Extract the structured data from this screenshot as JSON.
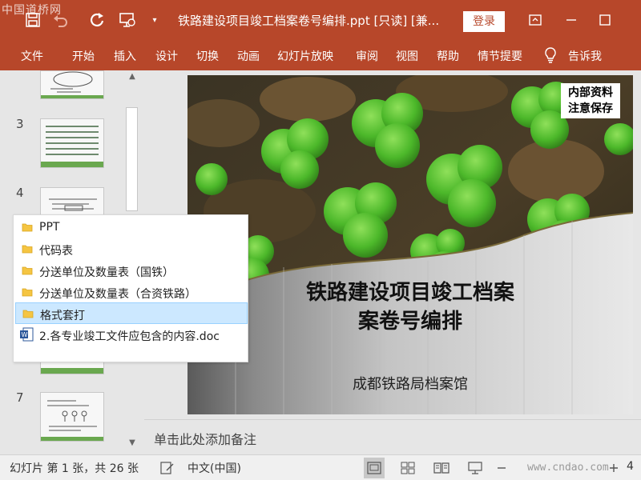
{
  "titlebar": {
    "watermark": "中国道桥网",
    "title": "铁路建设项目竣工档案卷号编排.ppt [只读] [兼...",
    "login": "登录"
  },
  "ribbon": {
    "tabs": [
      "文件",
      "开始",
      "插入",
      "设计",
      "切换",
      "动画",
      "幻灯片放映",
      "审阅",
      "视图",
      "帮助",
      "情节提要"
    ],
    "tell_me": "告诉我"
  },
  "thumbnails": {
    "numbers": [
      "3",
      "4",
      "7"
    ]
  },
  "popup": {
    "items": [
      {
        "label": "PPT",
        "icon": "folder-icon"
      },
      {
        "label": "代码表",
        "icon": "folder-icon"
      },
      {
        "label": "分送单位及数量表（国铁）",
        "icon": "folder-icon"
      },
      {
        "label": "分送单位及数量表（合资铁路）",
        "icon": "folder-icon"
      },
      {
        "label": "格式套打",
        "icon": "folder-icon",
        "selected": true
      },
      {
        "label": "2.各专业竣工文件应包含的内容.doc",
        "icon": "word-doc-icon"
      }
    ]
  },
  "slide": {
    "title_line1": "铁路建设项目竣工档案",
    "title_line2": "案卷号编排",
    "subtitle": "成都铁路局档案馆",
    "badge_line1": "内部资料",
    "badge_line2": "注意保存"
  },
  "notes": {
    "placeholder": "单击此处添加备注"
  },
  "statusbar": {
    "slide_info": "幻灯片 第 1 张，共 26 张",
    "language": "中文(中国)",
    "watermark": "www.cndao.com",
    "zoom_fragment": "4"
  },
  "colors": {
    "accent": "#b7472a",
    "popup_selected": "#cce8ff"
  }
}
